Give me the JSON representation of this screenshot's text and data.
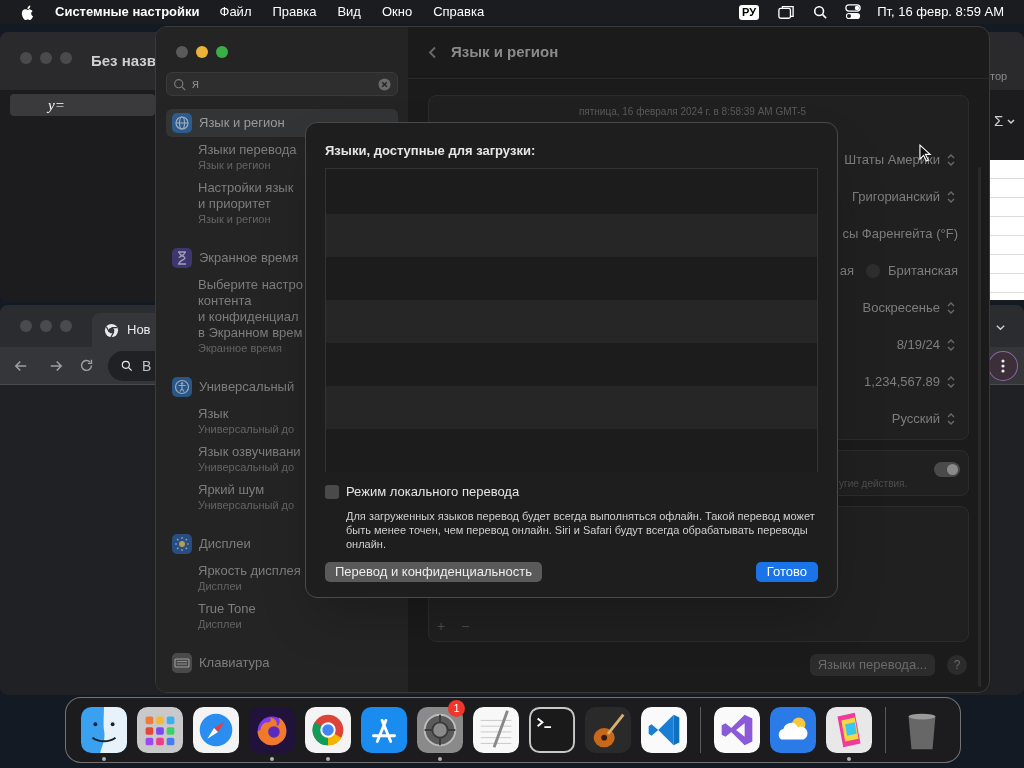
{
  "menu_bar": {
    "app": "Системные настройки",
    "menus": [
      "Файл",
      "Правка",
      "Вид",
      "Окно",
      "Справка"
    ],
    "input_source": "РУ",
    "clock": "Пт, 16 февр. 8:59 AM"
  },
  "back_window": {
    "title": "Без назв",
    "equation": "y=",
    "toolbar_text": "тор",
    "sum_button": "Σ"
  },
  "browser_window": {
    "tab_title": "Нов",
    "address_placeholder": "В"
  },
  "settings": {
    "search": {
      "value": "я"
    },
    "sidebar": [
      {
        "title": "Язык и регион",
        "selected": true,
        "results": [
          {
            "title_lines": [
              "Языки перевода"
            ],
            "subtitle": "Язык и регион"
          },
          {
            "title_lines": [
              "Настройки язык",
              "и приоритет"
            ],
            "subtitle": "Язык и регион"
          }
        ]
      },
      {
        "title": "Экранное время",
        "selected": false,
        "results": [
          {
            "title_lines": [
              "Выберите настро",
              "контента",
              "и конфиденциал",
              "в Экранном врем"
            ],
            "subtitle": "Экранное время"
          }
        ]
      },
      {
        "title": "Универсальный",
        "selected": false,
        "results": [
          {
            "title_lines": [
              "Язык"
            ],
            "subtitle": "Универсальный до"
          },
          {
            "title_lines": [
              "Язык озвучивани"
            ],
            "subtitle": "Универсальный до"
          },
          {
            "title_lines": [
              "Яркий шум"
            ],
            "subtitle": "Универсальный до"
          }
        ]
      },
      {
        "title": "Дисплеи",
        "selected": false,
        "results": [
          {
            "title_lines": [
              "Яркость дисплея"
            ],
            "subtitle": "Дисплеи"
          },
          {
            "title_lines": [
              "True Tone"
            ],
            "subtitle": "Дисплеи"
          }
        ]
      },
      {
        "title": "Клавиатура",
        "selected": false
      }
    ],
    "header": "Язык и регион",
    "datetime": "пятница, 16 февраля 2024 г. в 8:58:39 AM GMT-5",
    "rows": [
      {
        "kind": "popup",
        "value": "Штаты Америки"
      },
      {
        "kind": "popup",
        "value": "Григорианский"
      },
      {
        "kind": "text",
        "value": "сы Фаренгейта (°F)"
      },
      {
        "kind": "radio",
        "value": "ая",
        "option": {
          "label": "Британская",
          "selected": false
        }
      },
      {
        "kind": "popup",
        "value": "Воскресенье"
      },
      {
        "kind": "popup",
        "value": "8/19/24"
      },
      {
        "kind": "popup",
        "value": "1,234,567.89"
      },
      {
        "kind": "popup",
        "value": "Русский"
      }
    ],
    "toggle_card": {
      "hint": "угие действия.",
      "on": true
    },
    "list_buttons": [
      "+",
      "−"
    ],
    "translation_button": "Языки перевода...",
    "help_button": "?"
  },
  "dialog": {
    "title": "Языки, доступные для загрузки:",
    "checkbox": {
      "label": "Режим локального перевода",
      "checked": false
    },
    "description": "Для загруженных языков перевод будет всегда выполняться офлайн. Такой перевод может быть менее точен, чем перевод онлайн. Siri и Safari будут всегда обрабатывать переводы онлайн.",
    "secondary_button": "Перевод и конфиденциальность",
    "primary_button": "Готово"
  },
  "dock": {
    "groups": [
      [
        {
          "running": true
        },
        {
          "running": false
        },
        {
          "running": false
        },
        {
          "running": true
        },
        {
          "running": true
        },
        {
          "running": false
        },
        {
          "running": true,
          "badge": "1"
        },
        {
          "running": false
        },
        {
          "running": false
        },
        {
          "running": false
        },
        {
          "running": false
        }
      ],
      [
        {
          "running": false
        },
        {
          "running": false
        },
        {
          "running": true
        }
      ],
      [
        {
          "running": false
        }
      ]
    ]
  }
}
